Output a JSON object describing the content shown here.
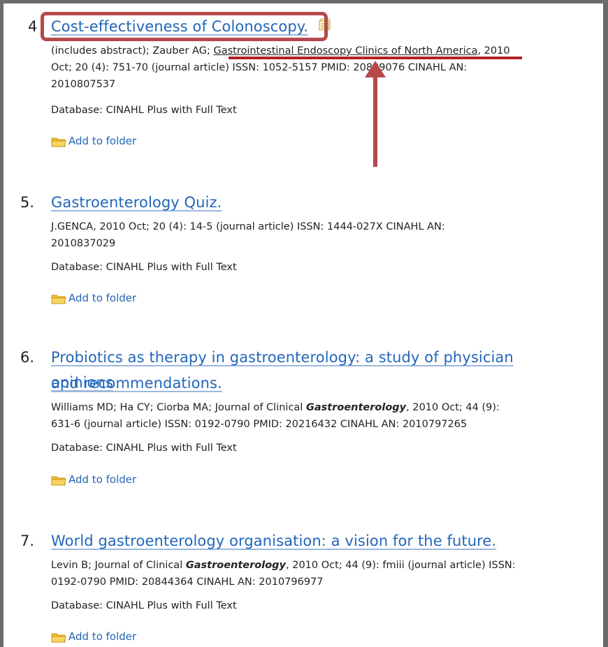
{
  "records": [
    {
      "number": "4",
      "title": "Cost-effectiveness of Colonoscopy.",
      "meta_prefix": "(includes abstract); Zauber AG; ",
      "meta_journal": "Gastrointestinal Endoscopy Clinics of North America",
      "meta_line1_suffix": ", 2010",
      "meta_line2": "Oct; 20 (4): 751-70 (journal article) ISSN: 1052-5157 PMID: 20889076 CINAHL AN:",
      "meta_line3": "2010807537",
      "database": "Database: CINAHL Plus with Full Text",
      "folder_label": "Add to folder"
    },
    {
      "number": "5.",
      "title": "Gastroenterology Quiz.",
      "meta_line1": "J.GENCA, 2010 Oct; 20 (4): 14-5 (journal article) ISSN: 1444-027X CINAHL AN:",
      "meta_line2": "2010837029",
      "database": "Database: CINAHL Plus with Full Text",
      "folder_label": "Add to folder"
    },
    {
      "number": "6.",
      "title_line1": "Probiotics as therapy in gastroenterology: a study of physician opinions",
      "title_line2": "and recommendations.",
      "meta_line1_prefix": "Williams MD; Ha CY; Ciorba MA; Journal of Clinical ",
      "meta_line1_em": "Gastroenterology",
      "meta_line1_suffix": ", 2010 Oct; 44 (9):",
      "meta_line2": "631-6 (journal article) ISSN: 0192-0790 PMID: 20216432 CINAHL AN: 2010797265",
      "database": "Database: CINAHL Plus with Full Text",
      "folder_label": "Add to folder"
    },
    {
      "number": "7.",
      "title": "World gastroenterology organisation: a vision for the future.",
      "meta_line1_prefix": "Levin B; Journal of Clinical ",
      "meta_line1_em": "Gastroenterology",
      "meta_line1_suffix": ", 2010 Oct; 44 (9): fmiii (journal article) ISSN:",
      "meta_line2": "0192-0790 PMID: 20844364 CINAHL AN: 2010796977",
      "database": "Database: CINAHL Plus with Full Text",
      "folder_label": "Add to folder"
    }
  ],
  "annotation_color": "#b5494b",
  "link_color": "#2266bb",
  "icons": [
    "folder-icon",
    "document-icon",
    "up-arrow-annotation"
  ]
}
